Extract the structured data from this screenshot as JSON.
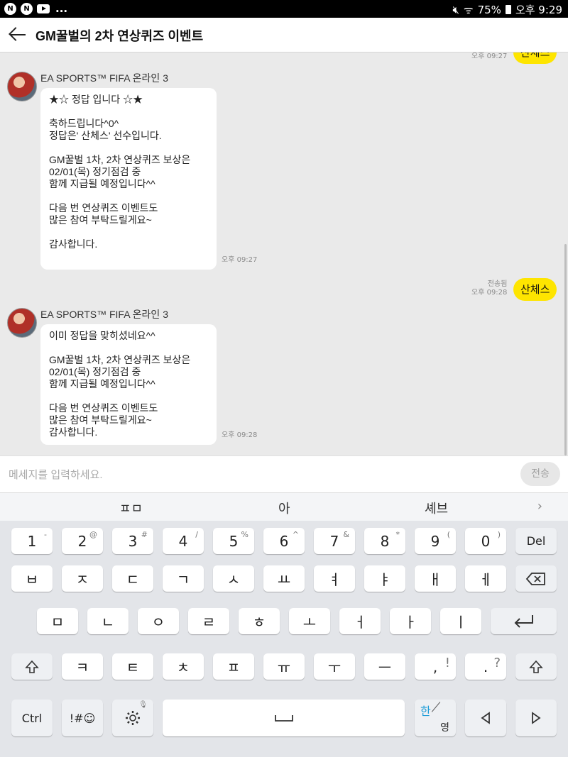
{
  "status": {
    "icons": [
      "naver-n-icon",
      "naver-n-icon",
      "youtube-icon"
    ],
    "more": "...",
    "battery": "75%",
    "time": "오후 9:29",
    "mute_icon": "mute-icon",
    "wifi_icon": "wifi-icon"
  },
  "header": {
    "title": "GM꿀벌의 2차 연상퀴즈 이벤트",
    "back_icon": "back-arrow-icon"
  },
  "messages": {
    "partial": {
      "time": "오후 09:27",
      "text": "산체스"
    },
    "m1": {
      "sender": "EA SPORTS™ FIFA 온라인 3",
      "text": "★☆ 정답 입니다 ☆★\n\n축하드립니다^0^\n정답은' 산체스' 선수입니다.\n\nGM꿀벌 1차, 2차 연상퀴즈 보상은\n02/01(목) 정기점검 중\n함께 지급될 예정입니다^^\n\n다음 번 연상퀴즈 이벤트도\n많은 참여 부탁드릴게요~\n\n감사합니다.",
      "time": "오후 09:27"
    },
    "mine": {
      "status": "전송됨",
      "time": "오후 09:28",
      "text": "산체스"
    },
    "m2": {
      "sender": "EA SPORTS™ FIFA 온라인 3",
      "text": "이미 정답을 맞히셨네요^^\n\nGM꿀벌 1차, 2차 연상퀴즈 보상은\n02/01(목) 정기점검 중\n함께 지급될 예정입니다^^\n\n다음 번 연상퀴즈 이벤트도\n많은 참여 부탁드릴게요~\n감사합니다.",
      "time": "오후 09:28"
    }
  },
  "input": {
    "placeholder": "메세지를 입력하세요.",
    "value": "",
    "send_label": "전송"
  },
  "suggestions": [
    "ㅍㅁ",
    "아",
    "셰브"
  ],
  "suggest_more": "›",
  "keys": {
    "row1": [
      "1",
      "2",
      "3",
      "4",
      "5",
      "6",
      "7",
      "8",
      "9",
      "0"
    ],
    "row1_sup": [
      "-",
      "@",
      "#",
      "/",
      "%",
      "^",
      "&",
      "*",
      "(",
      ")"
    ],
    "del": "Del",
    "row2": [
      "ㅂ",
      "ㅈ",
      "ㄷ",
      "ㄱ",
      "ㅅ",
      "ㅛ",
      "ㅕ",
      "ㅑ",
      "ㅐ",
      "ㅔ"
    ],
    "row3": [
      "ㅁ",
      "ㄴ",
      "ㅇ",
      "ㄹ",
      "ㅎ",
      "ㅗ",
      "ㅓ",
      "ㅏ",
      "ㅣ"
    ],
    "row4": [
      "ㅋ",
      "ㅌ",
      "ㅊ",
      "ㅍ",
      "ㅠ",
      "ㅜ",
      "ㅡ"
    ],
    "comma": ",",
    "comma_sup": "!",
    "period": ".",
    "period_sup": "?",
    "ctrl": "Ctrl",
    "symbols": "!#☺",
    "han": "한",
    "young": "영"
  }
}
